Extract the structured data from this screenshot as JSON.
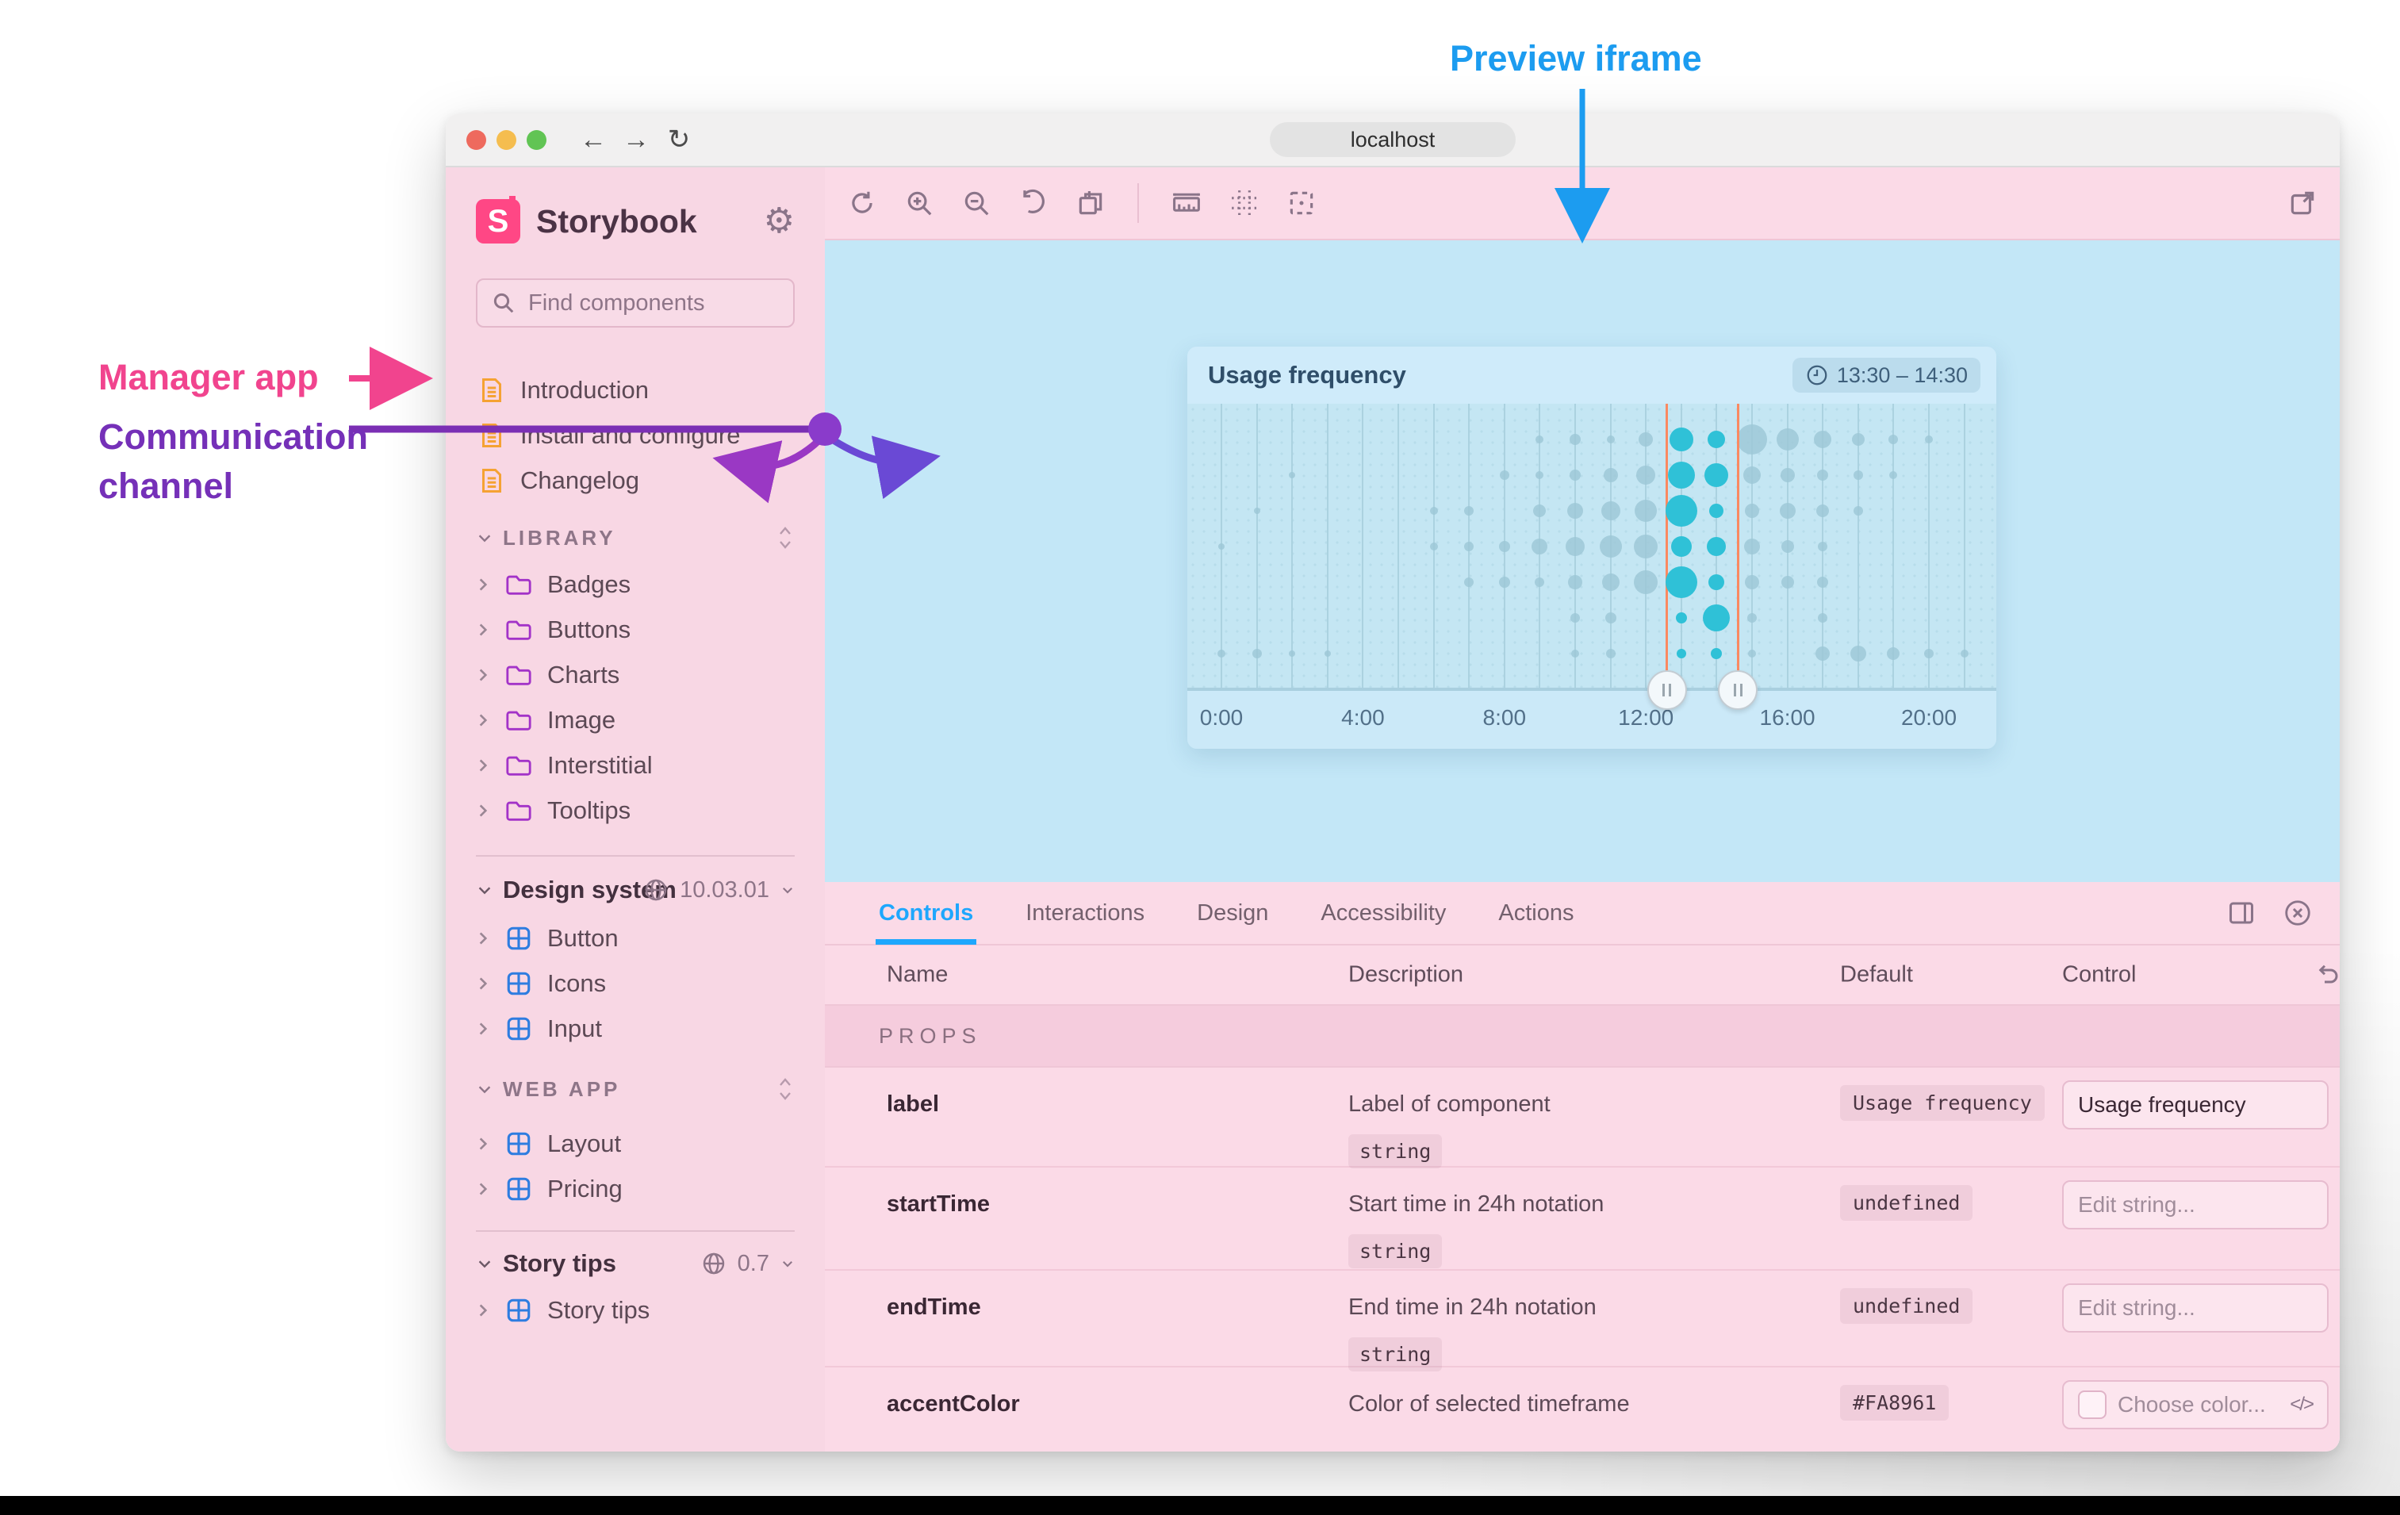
{
  "annotations": {
    "preview_iframe": "Preview iframe",
    "manager_app": "Manager app",
    "communication_line1": "Communication",
    "communication_line2": "channel",
    "colors": {
      "blue": "#1C9CF0",
      "pink": "#F1448E",
      "purple": "#7B2FB4",
      "purple_left": "#9A38C4",
      "purple_right": "#6A49D5"
    }
  },
  "browser": {
    "url": "localhost"
  },
  "icons": {
    "titlebar": [
      "back",
      "forward",
      "reload"
    ],
    "sidebar": [
      "storybook-logo",
      "gear",
      "search",
      "document",
      "folder",
      "component-grid",
      "globe",
      "sort",
      "chevron"
    ],
    "preview_toolbar": [
      "remount",
      "zoom-in",
      "zoom-out",
      "zoom-reset",
      "backgrounds",
      "ruler",
      "grid",
      "outline",
      "open-external"
    ],
    "panel": [
      "panel-position",
      "close",
      "undo",
      "clock",
      "code"
    ]
  },
  "sidebar": {
    "brand": "Storybook",
    "search": {
      "placeholder": "Find components",
      "shortcut": "/"
    },
    "doc_items": [
      "Introduction",
      "Install and configure",
      "Changelog"
    ],
    "library": {
      "label": "LIBRARY",
      "items": [
        "Badges",
        "Buttons",
        "Charts",
        "Image",
        "Interstitial",
        "Tooltips"
      ]
    },
    "design_system": {
      "label": "Design system",
      "version": "10.03.01",
      "items": [
        "Button",
        "Icons",
        "Input"
      ]
    },
    "web_app": {
      "label": "WEB APP",
      "items": [
        "Layout",
        "Pricing"
      ]
    },
    "story_tips": {
      "label": "Story tips",
      "version": "0.7",
      "items": [
        "Story tips"
      ]
    }
  },
  "chart": {
    "title": "Usage frequency",
    "time_badge": "13:30 – 14:30",
    "axis_ticks": [
      {
        "label": "0:00",
        "hour": 0
      },
      {
        "label": "4:00",
        "hour": 4
      },
      {
        "label": "8:00",
        "hour": 8
      },
      {
        "label": "12:00",
        "hour": 12
      },
      {
        "label": "16:00",
        "hour": 16
      },
      {
        "label": "20:00",
        "hour": 20
      }
    ],
    "selection": {
      "from_hour": 12.6,
      "to_hour": 14.6
    },
    "grid_hours": 22,
    "colors": {
      "accent": "#FA8961",
      "bubble": "#9CC7D6",
      "highlight": "#2FC1D7"
    },
    "bubbles": [
      [
        [
          9,
          10
        ],
        [
          10,
          14
        ],
        [
          11,
          10
        ],
        [
          12,
          18
        ],
        [
          13,
          30,
          1
        ],
        [
          14,
          22,
          1
        ],
        [
          15,
          38
        ],
        [
          16,
          28
        ],
        [
          17,
          22
        ],
        [
          18,
          16
        ],
        [
          19,
          12
        ],
        [
          20,
          10
        ]
      ],
      [
        [
          2,
          8
        ],
        [
          8,
          12
        ],
        [
          9,
          10
        ],
        [
          10,
          14
        ],
        [
          11,
          18
        ],
        [
          12,
          24
        ],
        [
          13,
          34,
          1
        ],
        [
          14,
          30,
          1
        ],
        [
          15,
          22
        ],
        [
          16,
          18
        ],
        [
          17,
          14
        ],
        [
          18,
          12
        ],
        [
          19,
          10
        ]
      ],
      [
        [
          1,
          8
        ],
        [
          6,
          10
        ],
        [
          7,
          12
        ],
        [
          9,
          16
        ],
        [
          10,
          20
        ],
        [
          11,
          24
        ],
        [
          12,
          28
        ],
        [
          13,
          40,
          1
        ],
        [
          14,
          18,
          1
        ],
        [
          15,
          18
        ],
        [
          16,
          20
        ],
        [
          17,
          16
        ],
        [
          18,
          12
        ]
      ],
      [
        [
          0,
          8
        ],
        [
          6,
          10
        ],
        [
          7,
          12
        ],
        [
          8,
          14
        ],
        [
          9,
          20
        ],
        [
          10,
          24
        ],
        [
          11,
          28
        ],
        [
          12,
          30
        ],
        [
          13,
          26,
          1
        ],
        [
          14,
          24,
          1
        ],
        [
          15,
          20
        ],
        [
          16,
          16
        ],
        [
          17,
          12
        ]
      ],
      [
        [
          7,
          12
        ],
        [
          8,
          14
        ],
        [
          9,
          12
        ],
        [
          10,
          18
        ],
        [
          11,
          22
        ],
        [
          12,
          30
        ],
        [
          13,
          40,
          1
        ],
        [
          14,
          20,
          1
        ],
        [
          15,
          18
        ],
        [
          16,
          16
        ],
        [
          17,
          14
        ]
      ],
      [
        [
          10,
          12
        ],
        [
          11,
          14
        ],
        [
          13,
          14,
          1
        ],
        [
          14,
          34,
          1
        ],
        [
          15,
          12
        ],
        [
          17,
          12
        ]
      ],
      [
        [
          0,
          10
        ],
        [
          1,
          12
        ],
        [
          2,
          8
        ],
        [
          3,
          8
        ],
        [
          10,
          10
        ],
        [
          11,
          12
        ],
        [
          13,
          12,
          1
        ],
        [
          14,
          14,
          1
        ],
        [
          15,
          10
        ],
        [
          17,
          18
        ],
        [
          18,
          20
        ],
        [
          19,
          16
        ],
        [
          20,
          12
        ],
        [
          21,
          10
        ]
      ]
    ]
  },
  "panel": {
    "tabs": [
      {
        "label": "Controls",
        "active": true
      },
      {
        "label": "Interactions",
        "active": false
      },
      {
        "label": "Design",
        "active": false
      },
      {
        "label": "Accessibility",
        "active": false
      },
      {
        "label": "Actions",
        "active": false
      }
    ],
    "columns": [
      "Name",
      "Description",
      "Default",
      "Control"
    ],
    "section": "PROPS",
    "rows": [
      {
        "name": "label",
        "desc": "Label of component",
        "type": "string",
        "default": "Usage frequency",
        "control": {
          "kind": "text",
          "value": "Usage frequency",
          "placeholder": ""
        }
      },
      {
        "name": "startTime",
        "desc": "Start time in 24h notation",
        "type": "string",
        "default": "undefined",
        "control": {
          "kind": "text",
          "value": "",
          "placeholder": "Edit string..."
        }
      },
      {
        "name": "endTime",
        "desc": "End time in 24h notation",
        "type": "string",
        "default": "undefined",
        "control": {
          "kind": "text",
          "value": "",
          "placeholder": "Edit string..."
        }
      },
      {
        "name": "accentColor",
        "desc": "Color of selected timeframe",
        "type": "",
        "default": "#FA8961",
        "control": {
          "kind": "color",
          "value": "",
          "placeholder": "Choose color..."
        }
      }
    ]
  }
}
